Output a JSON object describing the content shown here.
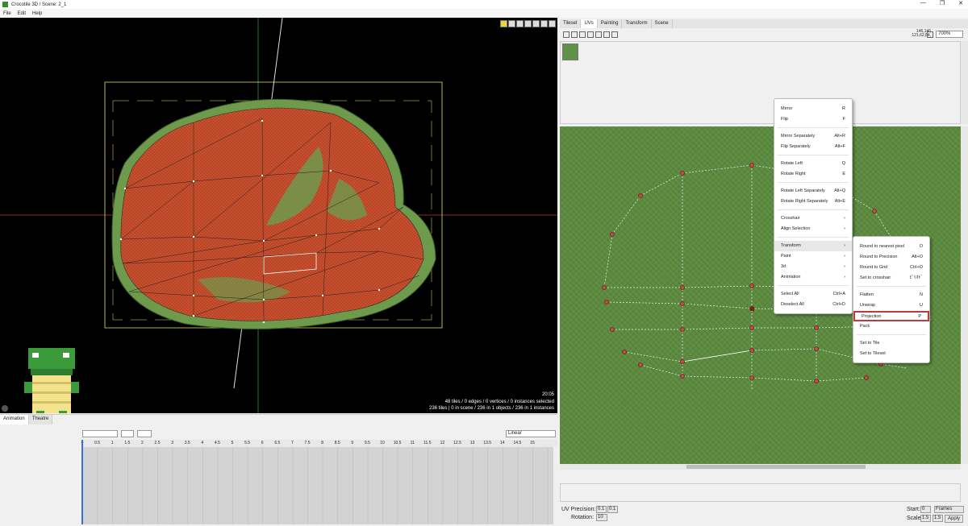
{
  "titlebar": {
    "title": "Crocotile 3D / Scene: 2_1",
    "minimize": "—",
    "restore": "❐",
    "close": "✕"
  },
  "menu": [
    "File",
    "Edit",
    "Help"
  ],
  "viewport": {
    "time": "20:05",
    "stats_line1": "48 tiles / 0 edges / 0 vertices / 0 instances selected",
    "stats_line2": "236 tiles | 0 in scene / 236 in 1 objects / 236 in 1 instances"
  },
  "animation": {
    "tabs": [
      "Animation",
      "Theatre"
    ],
    "interpolation": "Linear",
    "ruler": [
      "0",
      "0.5",
      "1",
      "1.5",
      "2",
      "2.5",
      "3",
      "3.5",
      "4",
      "4.5",
      "5",
      "5.5",
      "6",
      "6.5",
      "7",
      "7.5",
      "8",
      "8.5",
      "9",
      "9.5",
      "10",
      "10.5",
      "11",
      "11.5",
      "12",
      "12.5",
      "13",
      "13.5",
      "14",
      "14.5",
      "15"
    ]
  },
  "uv_panel": {
    "tabs": [
      "Tileset",
      "UVs",
      "Painting",
      "Transform",
      "Scene"
    ],
    "active_tab": "UVs",
    "coords_line1": "146,146",
    "coords_line2": "121,62,84,",
    "zoom": "700%"
  },
  "context_menu": {
    "items": [
      {
        "label": "Mirror",
        "shortcut": "R"
      },
      {
        "label": "Flip",
        "shortcut": "F"
      },
      {
        "label": "Mirror Separately",
        "shortcut": "Alt+R"
      },
      {
        "label": "Flip Separately",
        "shortcut": "Alt+F"
      },
      {
        "label": "Rotate Left",
        "shortcut": "Q"
      },
      {
        "label": "Rotate Right",
        "shortcut": "E"
      },
      {
        "label": "Rotate Left Separately",
        "shortcut": "Alt+Q"
      },
      {
        "label": "Rotate Right Separately",
        "shortcut": "Alt+E"
      },
      {
        "label": "Crosshair",
        "shortcut": "›"
      },
      {
        "label": "Align Selection",
        "shortcut": "›"
      },
      {
        "label": "Transform",
        "shortcut": "›"
      },
      {
        "label": "Paint",
        "shortcut": "›"
      },
      {
        "label": "3d",
        "shortcut": "›"
      },
      {
        "label": "Animation",
        "shortcut": "›"
      },
      {
        "label": "Select All",
        "shortcut": "Ctrl+A"
      },
      {
        "label": "Deselect All",
        "shortcut": "Ctrl+D"
      }
    ]
  },
  "submenu": {
    "items": [
      {
        "label": "Round to nearest pixel",
        "shortcut": "O"
      },
      {
        "label": "Round to Precision",
        "shortcut": "Alt+O"
      },
      {
        "label": "Round to Grid",
        "shortcut": "Ctrl+O"
      },
      {
        "label": "Set to crosshair",
        "shortcut": "ﾋﾟﾘｵﾄﾞ"
      },
      {
        "label": "Flatten",
        "shortcut": "N"
      },
      {
        "label": "Unwrap",
        "shortcut": "U"
      },
      {
        "label": "Projection",
        "shortcut": "P"
      },
      {
        "label": "Pack",
        "shortcut": ""
      },
      {
        "label": "Set to Tile",
        "shortcut": ""
      },
      {
        "label": "Set to Tileset",
        "shortcut": ""
      }
    ]
  },
  "footer": {
    "uv_precision_label": "UV Precision:",
    "uv_precision_x": "0.1",
    "uv_precision_y": "0.1",
    "rotation_label": "Rotation:",
    "rotation_value": "10",
    "start_label": "Start:",
    "start_value": "0",
    "frames_label": "Frames",
    "scale_label": "Scale:",
    "scale_x": "1.5",
    "scale_y": "1.5",
    "apply_label": "Apply"
  },
  "colors": {
    "accent": "#3b6fd6",
    "highlight_border": "#c0393b",
    "mesh_red": "#c8512f",
    "mesh_green": "#5f9148"
  }
}
